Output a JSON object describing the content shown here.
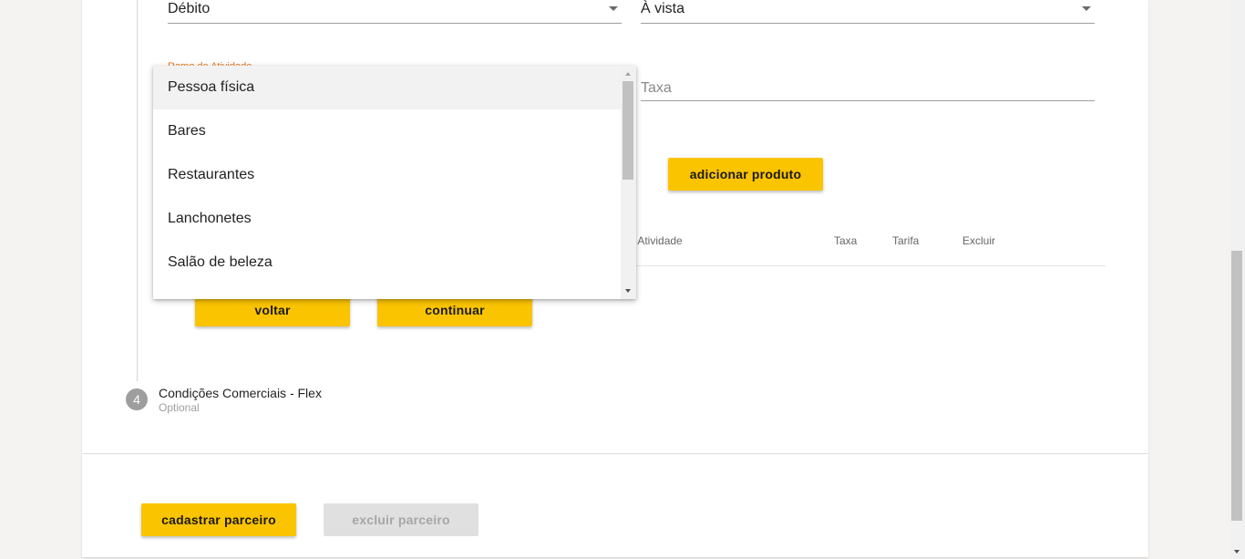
{
  "form": {
    "payment_type": "Débito",
    "installment": "À vista",
    "activity_label": "Ramo de Atividade",
    "rate_placeholder": "Taxa",
    "add_product_label": "adicionar produto"
  },
  "table": {
    "columns": [
      "Ramo de Atividade",
      "Taxa",
      "Tarifa",
      "Excluir"
    ],
    "visible_activity_header": "e Atividade"
  },
  "navigation": {
    "back_label": "voltar",
    "continue_label": "continuar"
  },
  "step4": {
    "number": "4",
    "title": "Condições Comerciais - Flex",
    "subtitle": "Optional"
  },
  "footer": {
    "register_label": "cadastrar parceiro",
    "delete_label": "excluir parceiro"
  },
  "dropdown": {
    "options": [
      "Pessoa física",
      "Bares",
      "Restaurantes",
      "Lanchonetes",
      "Salão de beleza"
    ],
    "selected_index": 0
  },
  "colors": {
    "accent": "#fbc400",
    "label_orange": "#e8751a",
    "disabled": "#e0e0e0"
  }
}
